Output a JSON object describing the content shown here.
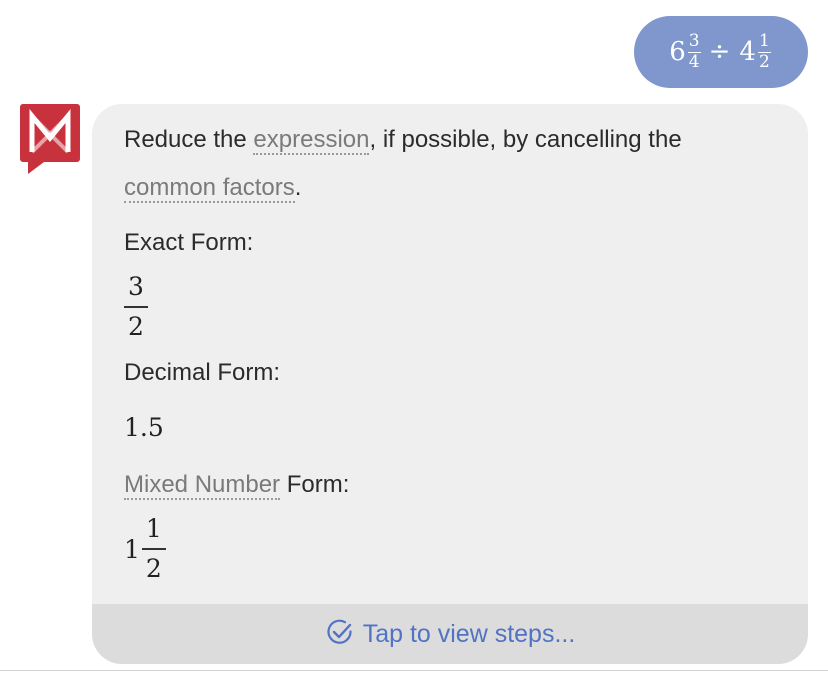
{
  "question": {
    "whole1": "6",
    "num1": "3",
    "den1": "4",
    "operator": "÷",
    "whole2": "4",
    "num2": "1",
    "den2": "2"
  },
  "answer": {
    "intro_before": "Reduce the ",
    "intro_link1": "expression",
    "intro_middle": ", if possible, by cancelling the",
    "intro_link2": "common factors",
    "intro_end": ".",
    "exact_label": "Exact Form:",
    "exact_num": "3",
    "exact_den": "2",
    "decimal_label": "Decimal Form:",
    "decimal_value": "1.5",
    "mixed_link": "Mixed Number",
    "mixed_label_rest": " Form:",
    "mixed_whole": "1",
    "mixed_num": "1",
    "mixed_den": "2"
  },
  "steps": {
    "label": "Tap to view steps..."
  },
  "colors": {
    "user_bubble": "#7f97cd",
    "card_bg": "#efefef",
    "steps_bar": "#dcdcdc",
    "steps_text": "#5272c4",
    "logo_red": "#c8323c"
  }
}
